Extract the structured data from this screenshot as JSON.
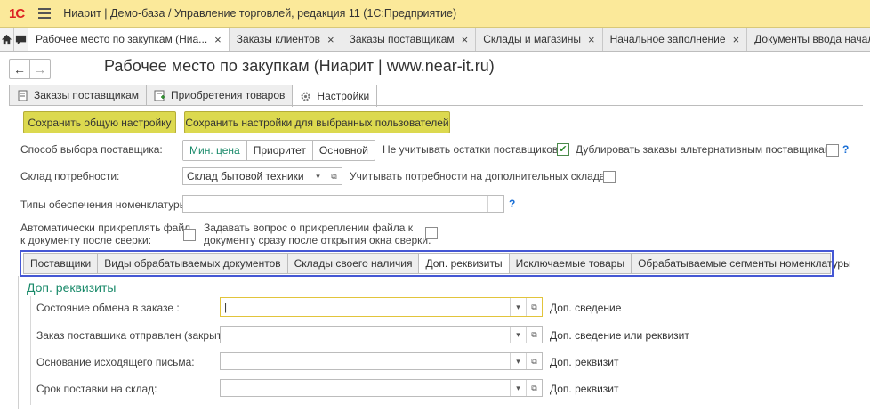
{
  "window": {
    "title": "Ниарит | Демо-база / Управление торговлей, редакция 11  (1С:Предприятие)",
    "logo": "1С"
  },
  "open_tabs": [
    {
      "label": "Рабочее место по закупкам (Ниа...",
      "close": "×"
    },
    {
      "label": "Заказы клиентов",
      "close": "×"
    },
    {
      "label": "Заказы поставщикам",
      "close": "×"
    },
    {
      "label": "Склады и магазины",
      "close": "×"
    },
    {
      "label": "Начальное заполнение",
      "close": "×"
    },
    {
      "label": "Документы ввода начальных"
    }
  ],
  "form": {
    "back": "←",
    "forward": "→",
    "title": "Рабочее место по закупкам (Ниарит | www.near-it.ru)"
  },
  "form_tabs": [
    {
      "label": "Заказы поставщикам",
      "icon": "document-icon"
    },
    {
      "label": "Приобретения товаров",
      "icon": "receipt-icon"
    },
    {
      "label": "Настройки",
      "icon": "gear-icon"
    }
  ],
  "buttons": {
    "save_common": "Сохранить общую настройку",
    "save_for_users": "Сохранить настройки для выбранных пользователей"
  },
  "supplier_choice": {
    "label": "Способ выбора поставщика:",
    "options": [
      "Мин. цена",
      "Приоритет",
      "Основной"
    ],
    "selected": "Мин. цена"
  },
  "ignore_supplier_stock": {
    "label": "Не учитывать остатки поставщиков:",
    "checked": true,
    "mark": "✔"
  },
  "duplicate_orders": {
    "label": "Дублировать заказы альтернативным поставщикам:",
    "checked": false
  },
  "help_mark": "?",
  "demand_warehouse": {
    "label": "Склад потребности:",
    "value": "Склад бытовой техники",
    "dropdown": "▾",
    "open": "⧉"
  },
  "extra_warehouses": {
    "label": "Учитывать потребности на дополнительных складах:",
    "checked": false
  },
  "supply_types": {
    "label": "Типы обеспечения номенклатуры:",
    "value": "",
    "dots": "..."
  },
  "auto_attach": {
    "line1": "Автоматически прикреплять файл",
    "line2": "к документу после сверки:",
    "checked": false
  },
  "ask_attach": {
    "line1": "Задавать вопрос о прикреплении файла к",
    "line2": "документу сразу после открытия окна сверки:",
    "checked": false
  },
  "inner_tabs": [
    "Поставщики",
    "Виды обрабатываемых документов",
    "Склады своего наличия",
    "Доп. реквизиты",
    "Исключаемые товары",
    "Обрабатываемые сегменты номенклатуры"
  ],
  "inner_tab_active": "Доп. реквизиты",
  "extra_props": {
    "header": "Доп. реквизиты",
    "rows": [
      {
        "label": "Состояние обмена в заказе :",
        "value": "|",
        "hint": "Доп. сведение"
      },
      {
        "label": "Заказ поставщика отправлен (закрыт):",
        "value": "",
        "hint": "Доп. сведение или реквизит"
      },
      {
        "label": "Основание исходящего письма:",
        "value": "",
        "hint": "Доп. реквизит"
      },
      {
        "label": "Срок поставки на склад:",
        "value": "",
        "hint": "Доп. реквизит"
      }
    ]
  }
}
